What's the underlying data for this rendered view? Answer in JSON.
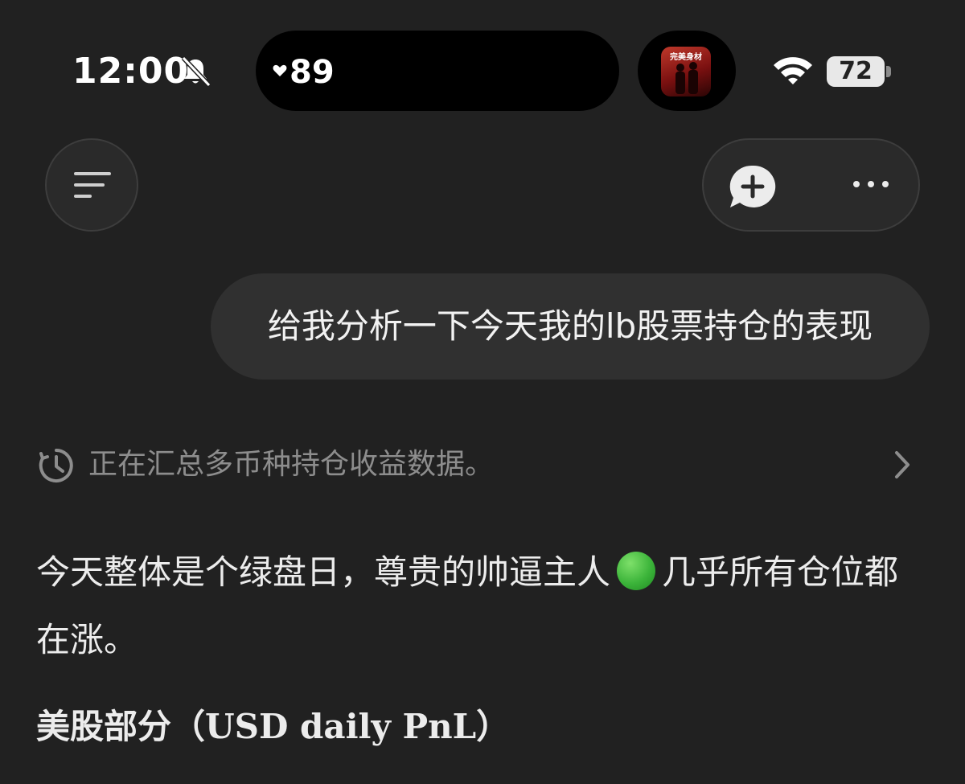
{
  "status_bar": {
    "time": "12:00",
    "silent_icon": "bell-slash-icon",
    "island_value": "89",
    "island_icon": "heart-icon",
    "thumbnail_text": "完美身材",
    "wifi_icon": "wifi-icon",
    "battery_level": "72"
  },
  "toolbar": {
    "menu_icon": "menu-lines-icon",
    "new_chat_icon": "new-chat-plus-icon",
    "more_icon": "more-dots-icon"
  },
  "conversation": {
    "user_message": "给我分析一下今天我的lb股票持仓的表现",
    "status_text": "正在汇总多币种持仓收益数据。",
    "reply_part1": "今天整体是个绿盘日，尊贵的帅逼主人",
    "reply_emoji": "green-circle-icon",
    "reply_part2": "几乎所有仓位都在涨。",
    "section_title_cn": "美股部分",
    "section_title_en": "（USD daily PnL）"
  },
  "colors": {
    "background": "#212121",
    "bubble": "#303030",
    "muted_text": "#8d8d8d",
    "green_dot": "#3cb43a"
  }
}
